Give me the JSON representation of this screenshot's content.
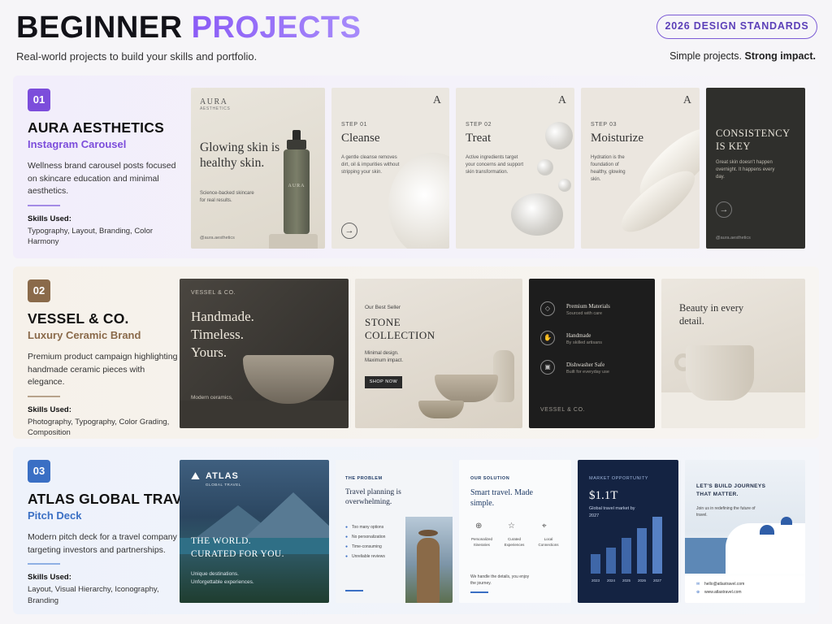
{
  "header": {
    "title_part1": "BEGINNER",
    "title_part2": "PROJECTS",
    "subtitle": "Real-world projects to build your skills and portfolio.",
    "badge": "2026 DESIGN STANDARDS",
    "tagline_normal": "Simple projects.",
    "tagline_bold": "Strong impact."
  },
  "colors": {
    "accent_purple": "#7c4ddb",
    "accent_brown": "#8a6a4a",
    "accent_blue": "#3a6fc4"
  },
  "skills_label": "Skills Used:",
  "projects": [
    {
      "number": "01",
      "name": "AURA AESTHETICS",
      "type": "Instagram Carousel",
      "description": "Wellness brand carousel posts focused on skincare education and minimal aesthetics.",
      "skills": "Typography, Layout, Branding, Color Harmony",
      "cards": {
        "c1": {
          "brand": "AURA",
          "brand_sub": "AESTHETICS",
          "headline": "Glowing skin is healthy skin.",
          "body": "Science-backed skincare for real results.",
          "handle": "@aura.aesthetics",
          "bottle_label": "AURA"
        },
        "c2": {
          "step": "STEP 01",
          "title": "Cleanse",
          "body": "A gentle cleanse removes dirt, oil & impurities without stripping your skin.",
          "mark": "A"
        },
        "c3": {
          "step": "STEP 02",
          "title": "Treat",
          "body": "Active ingredients target your concerns and support skin transformation.",
          "mark": "A"
        },
        "c4": {
          "step": "STEP 03",
          "title": "Moisturize",
          "body": "Hydration is the foundation of healthy, glowing skin.",
          "mark": "A"
        },
        "c5": {
          "title": "CONSISTENCY IS KEY",
          "body": "Great skin doesn't happen overnight. It happens every day.",
          "handle": "@aura.aesthetics"
        }
      }
    },
    {
      "number": "02",
      "name": "VESSEL & CO.",
      "type": "Luxury Ceramic Brand",
      "description": "Premium product campaign highlighting handmade ceramic pieces with elegance.",
      "skills": "Photography, Typography, Color Grading, Composition",
      "cards": {
        "c1": {
          "brand": "VESSEL & CO.",
          "headline": "Handmade. Timeless. Yours.",
          "body": "Modern ceramics, crafted with soul."
        },
        "c2": {
          "eyebrow": "Our Best Seller",
          "title": "STONE COLLECTION",
          "body": "Minimal design. Maximum impact.",
          "button": "SHOP NOW"
        },
        "c3": {
          "features": [
            {
              "title": "Premium Materials",
              "sub": "Sourced with care"
            },
            {
              "title": "Handmade",
              "sub": "By skilled artisans"
            },
            {
              "title": "Dishwasher Safe",
              "sub": "Built for everyday use"
            }
          ],
          "brand": "VESSEL & CO."
        },
        "c4": {
          "headline": "Beauty in every detail."
        }
      }
    },
    {
      "number": "03",
      "name": "ATLAS GLOBAL TRAVEL",
      "type": "Pitch Deck",
      "description": "Modern pitch deck for a travel company targeting investors and partnerships.",
      "skills": "Layout, Visual Hierarchy, Iconography, Branding",
      "cards": {
        "c1": {
          "brand": "ATLAS",
          "brand_sub": "GLOBAL TRAVEL",
          "headline": "THE WORLD. CURATED FOR YOU.",
          "body": "Unique destinations. Unforgettable experiences."
        },
        "c2": {
          "eyebrow": "THE PROBLEM",
          "title": "Travel planning is overwhelming.",
          "items": [
            "Too many options",
            "No personalization",
            "Time-consuming",
            "Unreliable reviews"
          ]
        },
        "c3": {
          "eyebrow": "OUR SOLUTION",
          "title": "Smart travel. Made simple.",
          "icons": [
            "Personalized Itineraries",
            "Curated Experiences",
            "Local Connections"
          ],
          "body": "We handle the details, you enjoy the journey."
        },
        "c4": {
          "eyebrow": "MARKET OPPORTUNITY",
          "value": "$1.1T",
          "body": "Global travel market by 2027",
          "years": [
            "2023",
            "2024",
            "2025",
            "2026",
            "2027"
          ]
        },
        "c5": {
          "title": "LET'S BUILD JOURNEYS THAT MATTER.",
          "body": "Join us in redefining the future of travel.",
          "email": "hello@atlastravel.com",
          "web": "www.atlastravel.com"
        }
      }
    }
  ]
}
